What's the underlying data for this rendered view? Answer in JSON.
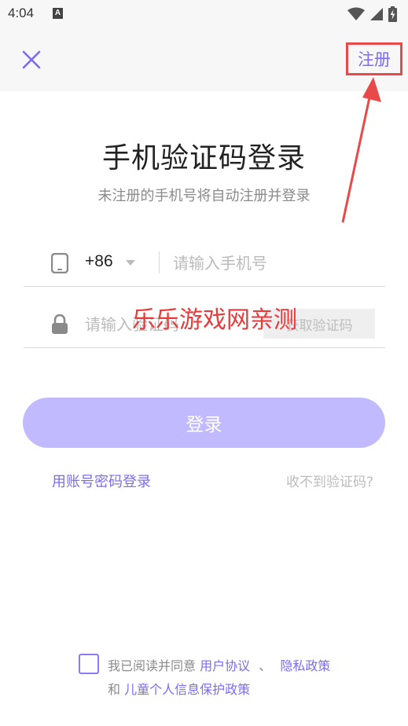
{
  "status_bar": {
    "time": "4:04",
    "notification_icon_letter": "A",
    "icons": [
      "wifi-icon",
      "signal-icon",
      "battery-charging-icon"
    ]
  },
  "top_bar": {
    "close_icon": "close-icon",
    "register_label": "注册"
  },
  "title": "手机验证码登录",
  "subtitle": "未注册的手机号将自动注册并登录",
  "phone": {
    "icon": "phone-icon",
    "country_code": "+86",
    "placeholder": "请输入手机号",
    "value": ""
  },
  "code": {
    "icon": "lock-icon",
    "placeholder": "请输入验证码",
    "value": "",
    "get_code_label": "获取验证码"
  },
  "watermark": "乐乐游戏网亲测",
  "login_label": "登录",
  "password_login_label": "用账号密码登录",
  "no_code_label": "收不到验证码?",
  "agreement": {
    "checked": false,
    "prefix": "我已阅读并同意",
    "user_agreement": "用户协议",
    "separator": "、",
    "privacy_policy": "隐私政策",
    "and": "和",
    "child_policy": "儿童个人信息保护政策"
  },
  "colors": {
    "accent": "#7b6cf0",
    "login_button": "#c2baff",
    "annotation_red": "#e84a4a"
  }
}
